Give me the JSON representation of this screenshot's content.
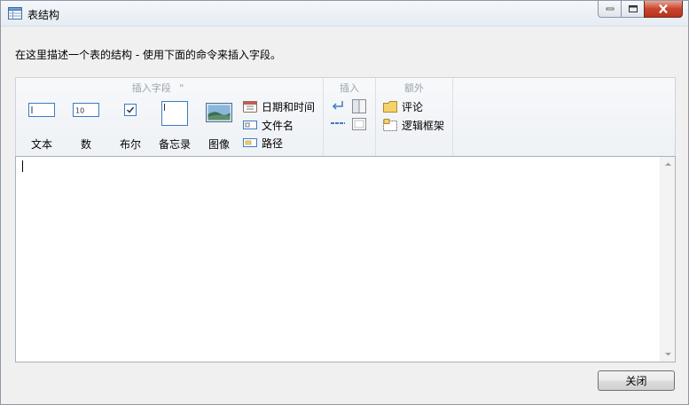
{
  "window": {
    "title": "表结构"
  },
  "description": "在这里描述一个表的结构 - 使用下面的命令来插入字段。",
  "ribbon": {
    "groups": {
      "insert_field": "插入字段",
      "insert_field_extra": "\"",
      "insert": "插入",
      "extra": "额外"
    },
    "big_buttons": {
      "text": "文本",
      "number": "数",
      "boolean": "布尔",
      "memo": "备忘录",
      "image": "图像"
    },
    "number_icon_text": "10",
    "small_buttons": {
      "datetime": "日期和时间",
      "filename": "文件名",
      "path": "路径",
      "comment": "评论",
      "logic_frame": "逻辑框架"
    }
  },
  "footer": {
    "close_label": "关闭"
  },
  "colors": {
    "close_caption": "#c9452d",
    "accent_blue": "#3d7bc4",
    "folder_yellow": "#f5d36b"
  }
}
